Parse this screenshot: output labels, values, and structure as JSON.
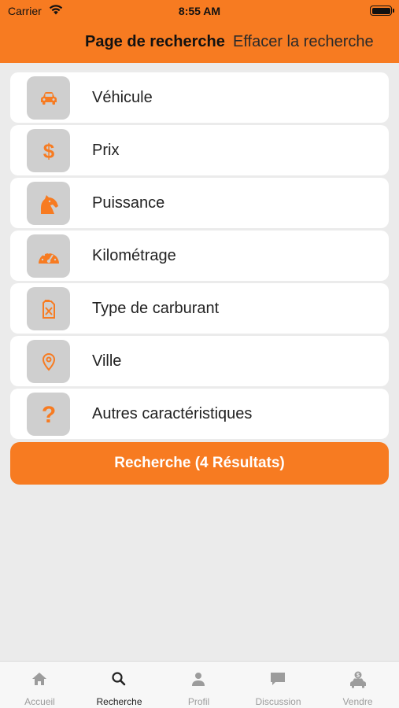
{
  "status_bar": {
    "carrier": "Carrier",
    "time": "8:55 AM"
  },
  "header": {
    "title": "Page de recherche",
    "clear_label": "Effacer la recherche"
  },
  "filters": [
    {
      "label": "Véhicule",
      "icon": "car-icon"
    },
    {
      "label": "Prix",
      "icon": "dollar-icon"
    },
    {
      "label": "Puissance",
      "icon": "horse-icon"
    },
    {
      "label": "Kilométrage",
      "icon": "speedometer-icon"
    },
    {
      "label": "Type de carburant",
      "icon": "fuel-can-icon"
    },
    {
      "label": "Ville",
      "icon": "map-pin-icon"
    },
    {
      "label": "Autres caractéristiques",
      "icon": "question-icon"
    }
  ],
  "search_button": {
    "label": "Recherche (4 Résultats)"
  },
  "tabs": [
    {
      "label": "Accueil",
      "icon": "home-icon",
      "active": false
    },
    {
      "label": "Recherche",
      "icon": "search-icon",
      "active": true
    },
    {
      "label": "Profil",
      "icon": "person-icon",
      "active": false
    },
    {
      "label": "Discussion",
      "icon": "chat-icon",
      "active": false
    },
    {
      "label": "Vendre",
      "icon": "car-sell-icon",
      "active": false
    }
  ],
  "colors": {
    "accent": "#f77b21",
    "tile": "#cfcfcf",
    "background": "#ebebeb"
  }
}
